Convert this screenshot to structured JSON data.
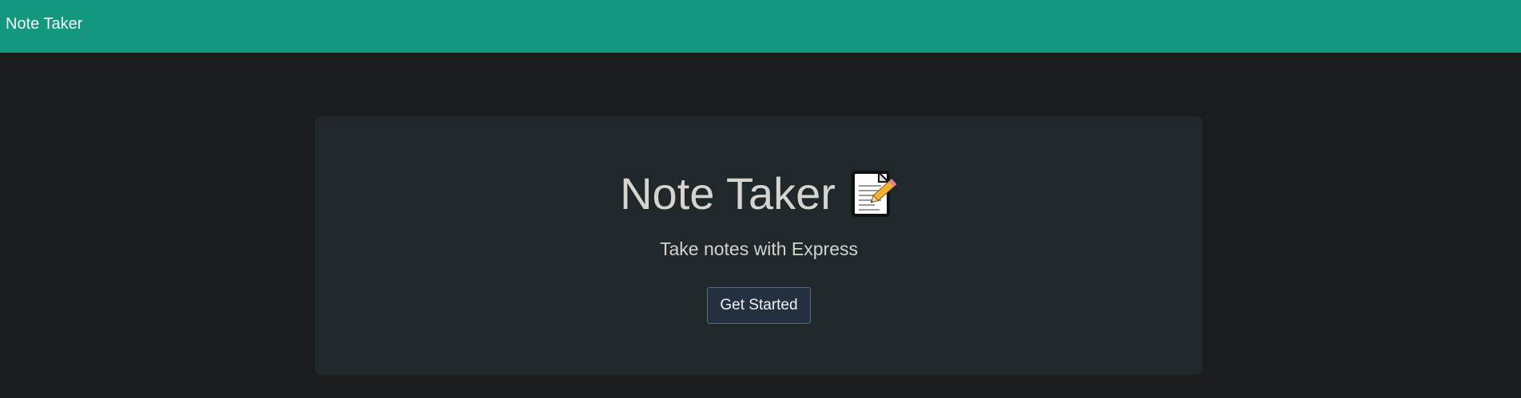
{
  "navbar": {
    "brand": "Note Taker",
    "background_color": "#14977f"
  },
  "hero": {
    "title": "Note Taker",
    "title_icon": "memo-icon",
    "subtitle": "Take notes with Express",
    "cta_label": "Get Started"
  },
  "colors": {
    "page_background": "#1b1c1e",
    "card_background": "#21282b",
    "button_background": "#233040"
  }
}
